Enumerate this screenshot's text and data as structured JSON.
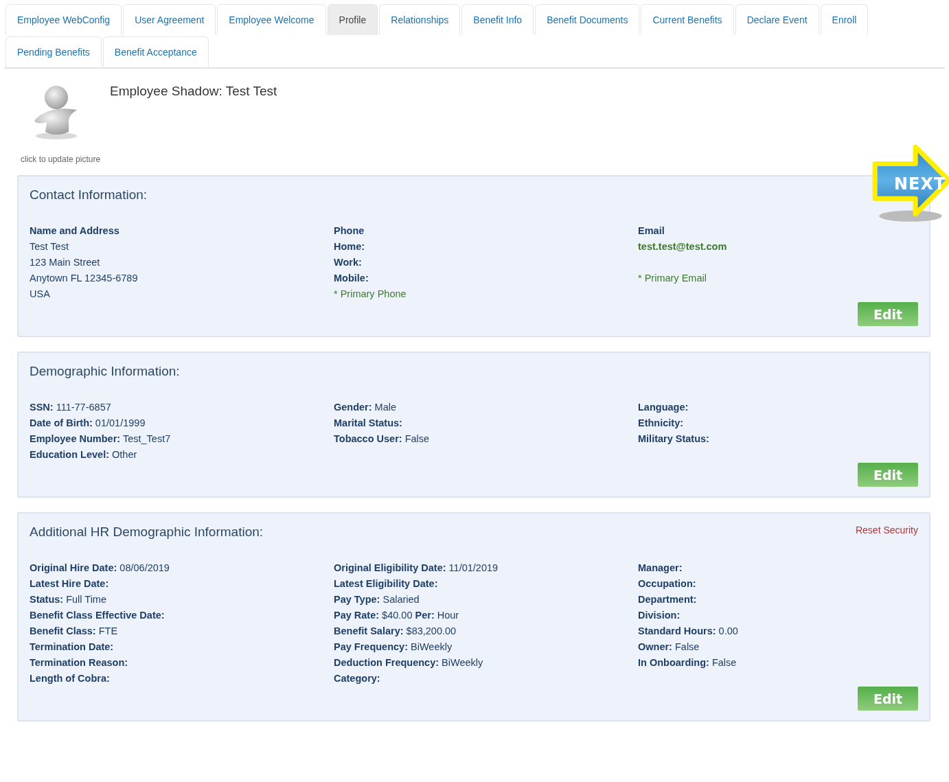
{
  "tab_rows": [
    [
      {
        "label": "Employee WebConfig",
        "selected": false
      },
      {
        "label": "User Agreement",
        "selected": false
      },
      {
        "label": "Employee Welcome",
        "selected": false
      },
      {
        "label": "Profile",
        "selected": true
      },
      {
        "label": "Relationships",
        "selected": false
      },
      {
        "label": "Benefit Info",
        "selected": false
      },
      {
        "label": "Benefit Documents",
        "selected": false
      },
      {
        "label": "Current Benefits",
        "selected": false
      },
      {
        "label": "Declare Event",
        "selected": false
      },
      {
        "label": "Enroll",
        "selected": false
      }
    ],
    [
      {
        "label": "Pending Benefits",
        "selected": false
      },
      {
        "label": "Benefit Acceptance",
        "selected": false
      }
    ]
  ],
  "profile": {
    "title": "Employee Shadow: Test Test",
    "picture_link": "click to update picture"
  },
  "next_button": "NEXT",
  "panels": [
    {
      "title": "Contact Information:",
      "columns": [
        [
          {
            "kind": "heading",
            "text": "Name and Address"
          },
          {
            "kind": "text",
            "text": "Test Test"
          },
          {
            "kind": "text",
            "text": "123 Main Street"
          },
          {
            "kind": "text",
            "text": "Anytown FL 12345-6789"
          },
          {
            "kind": "text",
            "text": "USA"
          }
        ],
        [
          {
            "kind": "heading",
            "text": "Phone"
          },
          {
            "kind": "label",
            "text": "Home:"
          },
          {
            "kind": "label",
            "text": "Work:"
          },
          {
            "kind": "label",
            "text": "Mobile:"
          },
          {
            "kind": "note",
            "text": "* Primary Phone"
          }
        ],
        [
          {
            "kind": "heading",
            "text": "Email"
          },
          {
            "kind": "email",
            "text": "test.test@test.com"
          },
          {
            "kind": "spaced-note",
            "text": "* Primary Email"
          }
        ]
      ],
      "button": "Edit"
    },
    {
      "title": "Demographic Information:",
      "columns": [
        [
          {
            "kind": "field",
            "text": "**SSN:** 111-77-6857"
          },
          {
            "kind": "field",
            "text": "**Date of Birth:** 01/01/1999"
          },
          {
            "kind": "field",
            "text": "**Employee Number:** Test_Test7"
          },
          {
            "kind": "field",
            "text": "**Education Level:** Other"
          }
        ],
        [
          {
            "kind": "field",
            "text": "**Gender:** Male"
          },
          {
            "kind": "label",
            "text": "Marital Status:"
          },
          {
            "kind": "field",
            "text": "**Tobacco User:** False"
          }
        ],
        [
          {
            "kind": "label",
            "text": "Language:"
          },
          {
            "kind": "label",
            "text": "Ethnicity:"
          },
          {
            "kind": "label",
            "text": "Military Status:"
          }
        ]
      ],
      "button": "Edit"
    },
    {
      "title": "Additional HR Demographic Information:",
      "link": "Reset Security",
      "columns": [
        [
          {
            "kind": "field",
            "text": "**Original Hire Date:** 08/06/2019"
          },
          {
            "kind": "label",
            "text": "Latest Hire Date:"
          },
          {
            "kind": "field",
            "text": "**Status:** Full Time"
          },
          {
            "kind": "label",
            "text": "Benefit Class Effective Date:"
          },
          {
            "kind": "field",
            "text": "**Benefit Class:** FTE"
          },
          {
            "kind": "label",
            "text": "Termination Date:"
          },
          {
            "kind": "label",
            "text": "Termination Reason:"
          },
          {
            "kind": "label",
            "text": "Length of Cobra:"
          }
        ],
        [
          {
            "kind": "field",
            "text": "**Original Eligibility Date:** 11/01/2019"
          },
          {
            "kind": "label",
            "text": "Latest Eligibility Date:"
          },
          {
            "kind": "field",
            "text": "**Pay Type:** Salaried"
          },
          {
            "kind": "field",
            "text": "**Pay Rate:** $40.00   **Per:** Hour"
          },
          {
            "kind": "field",
            "text": "**Benefit Salary:** $83,200.00"
          },
          {
            "kind": "field",
            "text": "**Pay Frequency:** BiWeekly"
          },
          {
            "kind": "field",
            "text": "**Deduction Frequency:** BiWeekly"
          },
          {
            "kind": "label",
            "text": "Category:"
          }
        ],
        [
          {
            "kind": "label",
            "text": "Manager:"
          },
          {
            "kind": "label",
            "text": "Occupation:"
          },
          {
            "kind": "label",
            "text": "Department:"
          },
          {
            "kind": "label",
            "text": "Division:"
          },
          {
            "kind": "field",
            "text": "**Standard Hours:** 0.00"
          },
          {
            "kind": "field",
            "text": "**Owner:** False"
          },
          {
            "kind": "field",
            "text": "**In Onboarding:** False"
          }
        ]
      ],
      "button": "Edit"
    }
  ]
}
